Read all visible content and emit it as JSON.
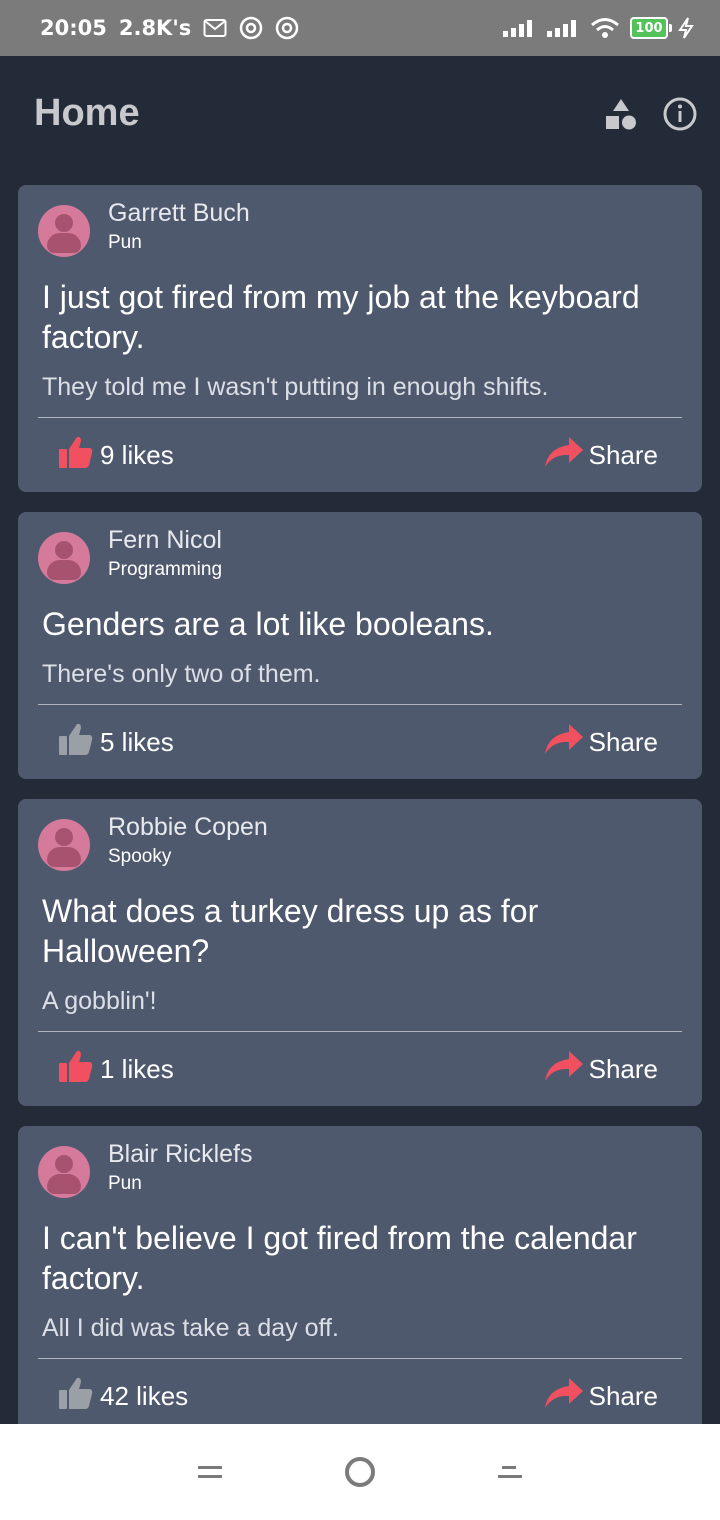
{
  "status_bar": {
    "time": "20:05",
    "speed": "2.8K's",
    "battery": "100",
    "icons": [
      "mail-icon",
      "at-icon",
      "at-icon",
      "signal-icon",
      "signal-icon",
      "wifi-icon",
      "battery-icon",
      "charging-icon"
    ]
  },
  "appbar": {
    "title": "Home",
    "icons": [
      "shapes-icon",
      "info-icon"
    ]
  },
  "colors": {
    "background": "#232a38",
    "card": "#4f596e",
    "accent": "#f0505f",
    "like_inactive": "#9aa0a6",
    "avatar": "#d67a9c"
  },
  "posts": [
    {
      "author": "Garrett Buch",
      "category": "Pun",
      "joke": "I just got fired from my job at the keyboard factory.",
      "punchline": "They told me I wasn't putting in enough shifts.",
      "likes": "9 likes",
      "liked": true,
      "share": "Share"
    },
    {
      "author": "Fern Nicol",
      "category": "Programming",
      "joke": "Genders are a lot like booleans.",
      "punchline": "There's only two of them.",
      "likes": "5 likes",
      "liked": false,
      "share": "Share"
    },
    {
      "author": "Robbie Copen",
      "category": "Spooky",
      "joke": "What does a turkey dress up as for Halloween?",
      "punchline": "A gobblin'!",
      "likes": "1 likes",
      "liked": true,
      "share": "Share"
    },
    {
      "author": "Blair Ricklefs",
      "category": "Pun",
      "joke": "I can't believe I got fired from the calendar factory.",
      "punchline": "All I did was take a day off.",
      "likes": "42 likes",
      "liked": false,
      "share": "Share"
    }
  ],
  "navbar": {
    "icons": [
      "menu-icon",
      "home-icon",
      "back-icon"
    ]
  }
}
